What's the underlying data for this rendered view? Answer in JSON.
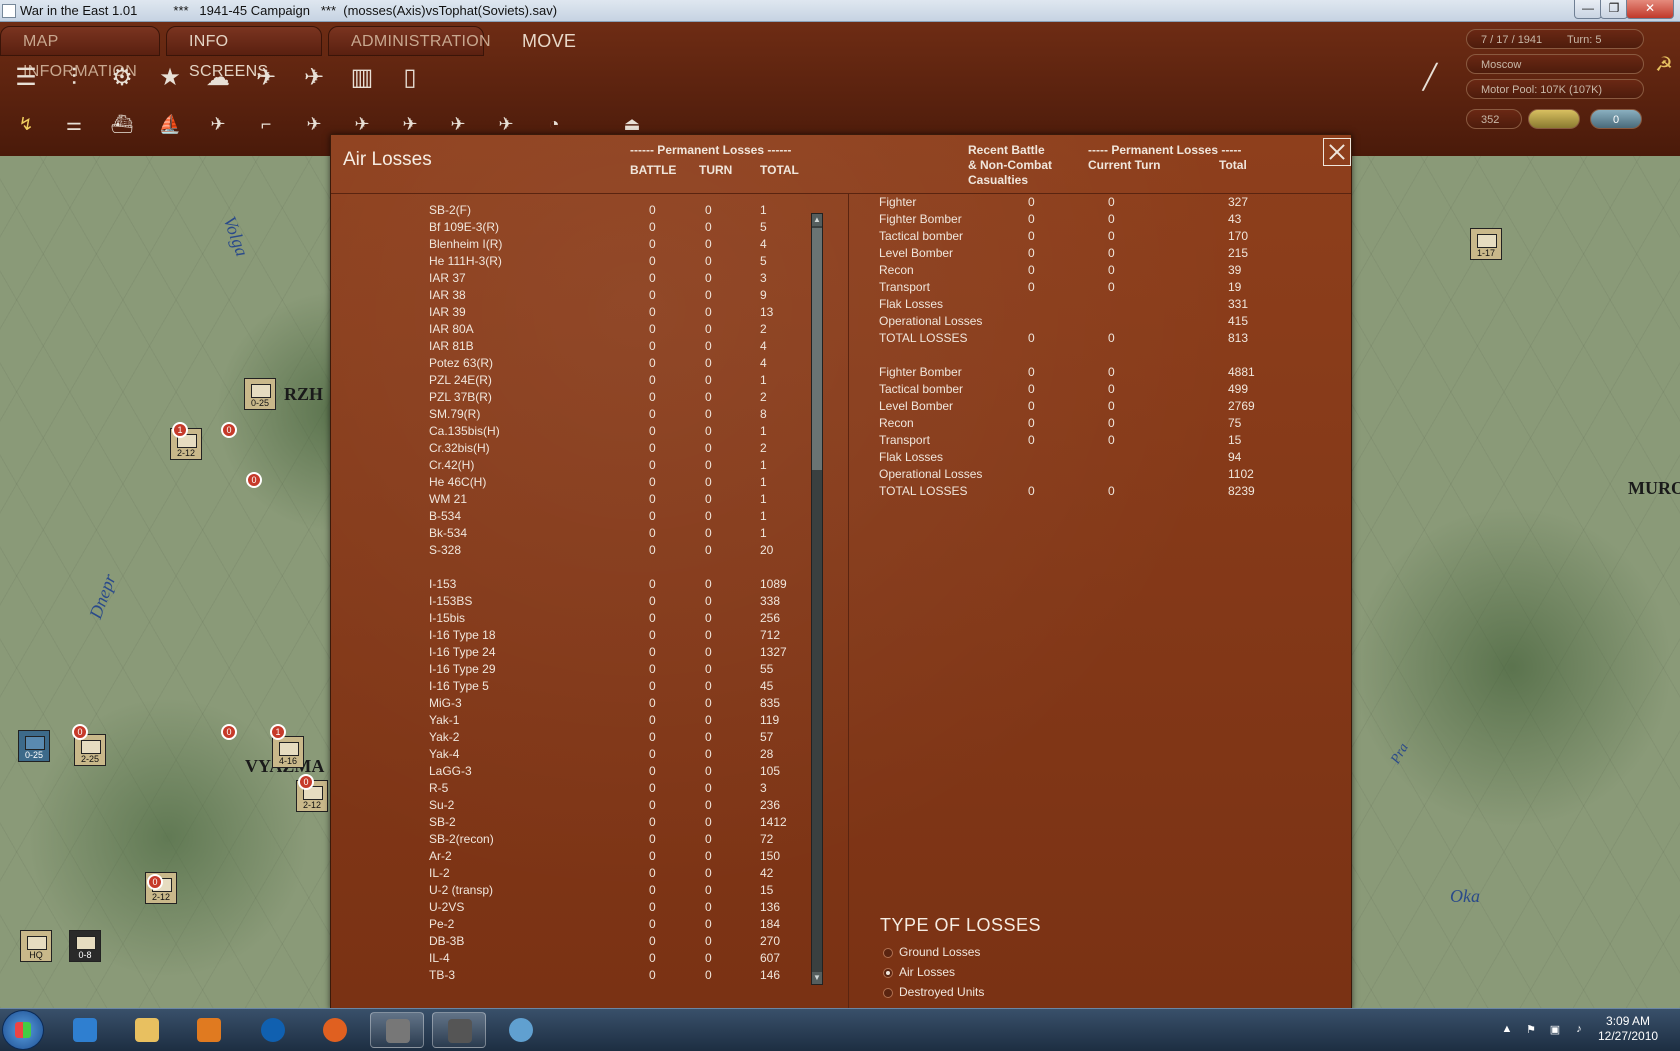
{
  "window": {
    "title": "War in the East 1.01          ***   1941-45 Campaign   ***  (mosses(Axis)vsTophat(Soviets).sav)",
    "min_label": "—",
    "max_label": "❐",
    "close_label": "✕"
  },
  "menu": {
    "tabs": [
      "MAP INFORMATION",
      "INFO SCREENS",
      "ADMINISTRATION",
      "MOVE"
    ]
  },
  "status": {
    "date": "7 / 17 / 1941",
    "turn": "Turn: 5",
    "city": "Moscow",
    "motor_pool": "Motor Pool: 107K (107K)",
    "value": "352",
    "counter": "0"
  },
  "map": {
    "cities": [
      "RZH",
      "VYAZMA",
      "MURO"
    ],
    "rivers": [
      "Volga",
      "Dnepr",
      "Oka",
      "Pra"
    ],
    "units": [
      "0-25",
      "2-12",
      "0-25",
      "2-25",
      "4-16",
      "2-12",
      "2-12",
      "HQ",
      "0-25",
      "0-8",
      "1-17"
    ],
    "badges": [
      "1",
      "0",
      "0",
      "1",
      "0",
      "0",
      "0",
      "0",
      "0",
      "0"
    ]
  },
  "dialog": {
    "title": "Air Losses",
    "left_header_group": "------ Permanent Losses ------",
    "left_headers": [
      "BATTLE",
      "TURN",
      "TOTAL"
    ],
    "right_header_recent": "Recent Battle\n& Non-Combat\nCasualties",
    "right_header_group": "----- Permanent Losses -----",
    "right_headers": [
      "Current Turn",
      "Total"
    ],
    "left_rows": [
      {
        "name": "SB-2(F)",
        "battle": "0",
        "turn": "0",
        "total": "1"
      },
      {
        "name": "Bf 109E-3(R)",
        "battle": "0",
        "turn": "0",
        "total": "5"
      },
      {
        "name": "Blenheim I(R)",
        "battle": "0",
        "turn": "0",
        "total": "4"
      },
      {
        "name": "He 111H-3(R)",
        "battle": "0",
        "turn": "0",
        "total": "5"
      },
      {
        "name": "IAR 37",
        "battle": "0",
        "turn": "0",
        "total": "3"
      },
      {
        "name": "IAR 38",
        "battle": "0",
        "turn": "0",
        "total": "9"
      },
      {
        "name": "IAR 39",
        "battle": "0",
        "turn": "0",
        "total": "13"
      },
      {
        "name": "IAR 80A",
        "battle": "0",
        "turn": "0",
        "total": "2"
      },
      {
        "name": "IAR 81B",
        "battle": "0",
        "turn": "0",
        "total": "4"
      },
      {
        "name": "Potez 63(R)",
        "battle": "0",
        "turn": "0",
        "total": "4"
      },
      {
        "name": "PZL 24E(R)",
        "battle": "0",
        "turn": "0",
        "total": "1"
      },
      {
        "name": "PZL 37B(R)",
        "battle": "0",
        "turn": "0",
        "total": "2"
      },
      {
        "name": "SM.79(R)",
        "battle": "0",
        "turn": "0",
        "total": "8"
      },
      {
        "name": "Ca.135bis(H)",
        "battle": "0",
        "turn": "0",
        "total": "1"
      },
      {
        "name": "Cr.32bis(H)",
        "battle": "0",
        "turn": "0",
        "total": "2"
      },
      {
        "name": "Cr.42(H)",
        "battle": "0",
        "turn": "0",
        "total": "1"
      },
      {
        "name": "He 46C(H)",
        "battle": "0",
        "turn": "0",
        "total": "1"
      },
      {
        "name": "WM 21",
        "battle": "0",
        "turn": "0",
        "total": "1"
      },
      {
        "name": "B-534",
        "battle": "0",
        "turn": "0",
        "total": "1"
      },
      {
        "name": "Bk-534",
        "battle": "0",
        "turn": "0",
        "total": "1"
      },
      {
        "name": "S-328",
        "battle": "0",
        "turn": "0",
        "total": "20"
      },
      {
        "name": "",
        "battle": "",
        "turn": "",
        "total": ""
      },
      {
        "name": "I-153",
        "battle": "0",
        "turn": "0",
        "total": "1089"
      },
      {
        "name": "I-153BS",
        "battle": "0",
        "turn": "0",
        "total": "338"
      },
      {
        "name": "I-15bis",
        "battle": "0",
        "turn": "0",
        "total": "256"
      },
      {
        "name": "I-16 Type 18",
        "battle": "0",
        "turn": "0",
        "total": "712"
      },
      {
        "name": "I-16 Type 24",
        "battle": "0",
        "turn": "0",
        "total": "1327"
      },
      {
        "name": "I-16 Type 29",
        "battle": "0",
        "turn": "0",
        "total": "55"
      },
      {
        "name": "I-16 Type 5",
        "battle": "0",
        "turn": "0",
        "total": "45"
      },
      {
        "name": "MiG-3",
        "battle": "0",
        "turn": "0",
        "total": "835"
      },
      {
        "name": "Yak-1",
        "battle": "0",
        "turn": "0",
        "total": "119"
      },
      {
        "name": "Yak-2",
        "battle": "0",
        "turn": "0",
        "total": "57"
      },
      {
        "name": "Yak-4",
        "battle": "0",
        "turn": "0",
        "total": "28"
      },
      {
        "name": "LaGG-3",
        "battle": "0",
        "turn": "0",
        "total": "105"
      },
      {
        "name": "R-5",
        "battle": "0",
        "turn": "0",
        "total": "3"
      },
      {
        "name": "Su-2",
        "battle": "0",
        "turn": "0",
        "total": "236"
      },
      {
        "name": "SB-2",
        "battle": "0",
        "turn": "0",
        "total": "1412"
      },
      {
        "name": "SB-2(recon)",
        "battle": "0",
        "turn": "0",
        "total": "72"
      },
      {
        "name": "Ar-2",
        "battle": "0",
        "turn": "0",
        "total": "150"
      },
      {
        "name": "IL-2",
        "battle": "0",
        "turn": "0",
        "total": "42"
      },
      {
        "name": "U-2 (transp)",
        "battle": "0",
        "turn": "0",
        "total": "15"
      },
      {
        "name": "U-2VS",
        "battle": "0",
        "turn": "0",
        "total": "136"
      },
      {
        "name": "Pe-2",
        "battle": "0",
        "turn": "0",
        "total": "184"
      },
      {
        "name": "DB-3B",
        "battle": "0",
        "turn": "0",
        "total": "270"
      },
      {
        "name": "IL-4",
        "battle": "0",
        "turn": "0",
        "total": "607"
      },
      {
        "name": "TB-3",
        "battle": "0",
        "turn": "0",
        "total": "146"
      }
    ],
    "right_rows": [
      {
        "name": "Fighter",
        "recent": "0",
        "current": "0",
        "total": "327"
      },
      {
        "name": "Fighter Bomber",
        "recent": "0",
        "current": "0",
        "total": "43"
      },
      {
        "name": "Tactical bomber",
        "recent": "0",
        "current": "0",
        "total": "170"
      },
      {
        "name": "Level Bomber",
        "recent": "0",
        "current": "0",
        "total": "215"
      },
      {
        "name": "Recon",
        "recent": "0",
        "current": "0",
        "total": "39"
      },
      {
        "name": "Transport",
        "recent": "0",
        "current": "0",
        "total": "19"
      },
      {
        "name": "Flak Losses",
        "recent": "",
        "current": "",
        "total": "331"
      },
      {
        "name": "Operational Losses",
        "recent": "",
        "current": "",
        "total": "415"
      },
      {
        "name": "TOTAL LOSSES",
        "recent": "0",
        "current": "0",
        "total": "813"
      },
      {
        "name": "",
        "recent": "",
        "current": "",
        "total": ""
      },
      {
        "name": "Fighter Bomber",
        "recent": "0",
        "current": "0",
        "total": "4881"
      },
      {
        "name": "Tactical bomber",
        "recent": "0",
        "current": "0",
        "total": "499"
      },
      {
        "name": "Level Bomber",
        "recent": "0",
        "current": "0",
        "total": "2769"
      },
      {
        "name": "Recon",
        "recent": "0",
        "current": "0",
        "total": "75"
      },
      {
        "name": "Transport",
        "recent": "0",
        "current": "0",
        "total": "15"
      },
      {
        "name": "Flak Losses",
        "recent": "",
        "current": "",
        "total": "94"
      },
      {
        "name": "Operational Losses",
        "recent": "",
        "current": "",
        "total": "1102"
      },
      {
        "name": "TOTAL LOSSES",
        "recent": "0",
        "current": "0",
        "total": "8239"
      }
    ],
    "type_title": "TYPE OF LOSSES",
    "type_options": [
      {
        "label": "Ground Losses",
        "selected": false
      },
      {
        "label": "Air Losses",
        "selected": true
      },
      {
        "label": "Destroyed Units",
        "selected": false
      }
    ]
  },
  "taskbar": {
    "time": "3:09 AM",
    "date": "12/27/2010"
  }
}
